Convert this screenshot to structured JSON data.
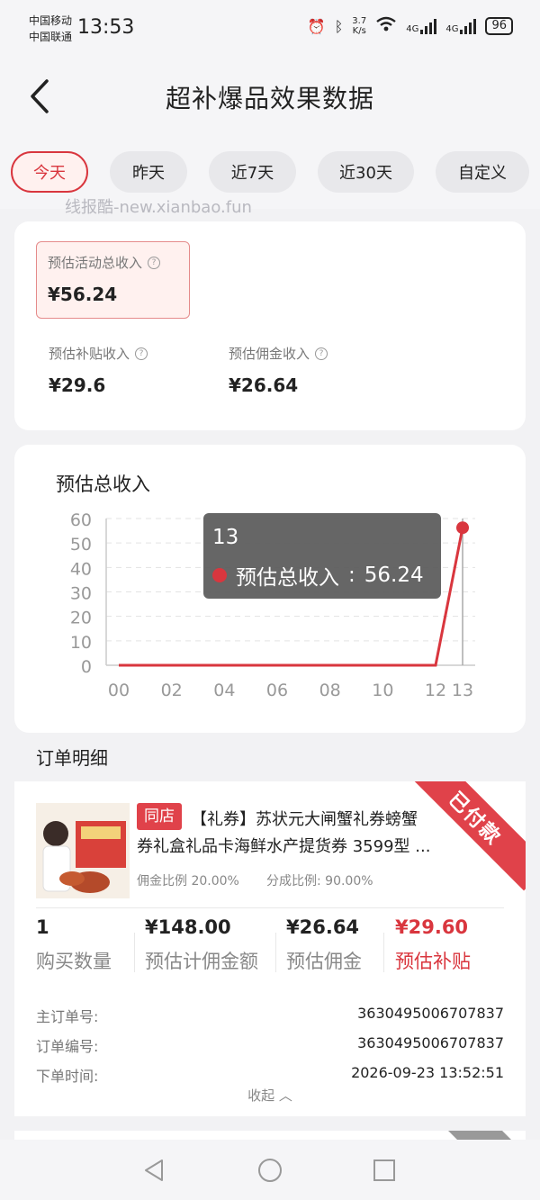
{
  "status_bar": {
    "carrier_1": "中国移动",
    "carrier_2": "中国联通",
    "time": "13:53",
    "net_speed_value": "3.7",
    "net_speed_unit": "K/s",
    "sim1_tag": "4G",
    "sim2_tag": "4G",
    "battery": "96"
  },
  "header": {
    "title": "超补爆品效果数据",
    "back_icon": "back-arrow-icon"
  },
  "date_tabs": {
    "items": [
      {
        "label": "今天",
        "active": true
      },
      {
        "label": "昨天",
        "active": false
      },
      {
        "label": "近7天",
        "active": false
      },
      {
        "label": "近30天",
        "active": false
      },
      {
        "label": "自定义",
        "active": false
      }
    ]
  },
  "watermark": "线报酷-new.xianbao.fun",
  "summary": {
    "total_label": "预估活动总收入",
    "total_value": "¥56.24",
    "subsidy_label": "预估补贴收入",
    "subsidy_value": "¥29.6",
    "commission_label": "预估佣金收入",
    "commission_value": "¥26.64"
  },
  "chart_data": {
    "type": "line",
    "title": "预估总收入",
    "x": [
      0,
      1,
      2,
      3,
      4,
      5,
      6,
      7,
      8,
      9,
      10,
      11,
      12,
      13
    ],
    "x_tick_labels": [
      "00",
      "02",
      "04",
      "06",
      "08",
      "10",
      "12",
      "13"
    ],
    "series": [
      {
        "name": "预估总收入",
        "values": [
          0,
          0,
          0,
          0,
          0,
          0,
          0,
          0,
          0,
          0,
          0,
          0,
          0,
          56.24
        ]
      }
    ],
    "y_ticks": [
      0,
      10,
      20,
      30,
      40,
      50,
      60
    ],
    "ylim": [
      0,
      60
    ],
    "grid": true,
    "line_color": "#d9363e",
    "tooltip": {
      "x": "13",
      "series_name": "预估总收入",
      "separator": ":",
      "value": "56.24"
    }
  },
  "orders": {
    "section_title": "订单明细",
    "items": [
      {
        "status_ribbon": "已付款",
        "store_tag": "同店",
        "product_line1": "【礼券】苏状元大闸蟹礼券螃蟹",
        "product_line2": "券礼盒礼品卡海鲜水产提货券 3599型 ...",
        "commission_rate_label": "佣金比例",
        "commission_rate_value": "20.00%",
        "share_rate_label": "分成比例:",
        "share_rate_value": "90.00%",
        "stats": [
          {
            "value": "1",
            "label": "购买数量"
          },
          {
            "value": "¥148.00",
            "label": "预估计佣金额"
          },
          {
            "value": "¥26.64",
            "label": "预估佣金"
          },
          {
            "value": "¥29.60",
            "label": "预估补贴"
          }
        ],
        "main_order_label": "主订单号:",
        "main_order_value": "3630495006707837",
        "order_no_label": "订单编号:",
        "order_no_value": "3630495006707837",
        "order_time_label": "下单时间:",
        "order_time_value": "2026-09-23 13:52:51",
        "collapse_label": "收起"
      }
    ]
  },
  "colors": {
    "accent": "#d9363e",
    "background": "#f2f2f4",
    "card": "#ffffff"
  }
}
